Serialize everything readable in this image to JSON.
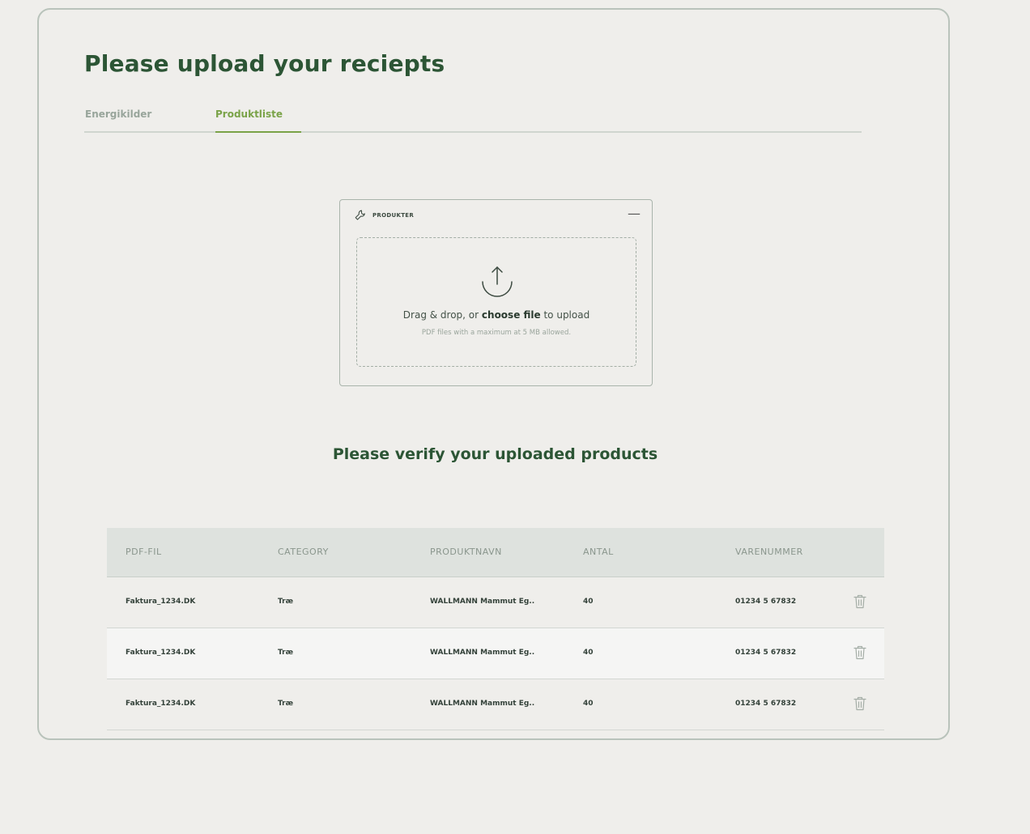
{
  "page": {
    "title": "Please upload your reciepts"
  },
  "tabs": [
    {
      "label": "Energikilder",
      "active": false
    },
    {
      "label": "Produktliste",
      "active": true
    }
  ],
  "upload": {
    "panel_title": "PRODUKTER",
    "minimize_symbol": "—",
    "text_before": "Drag & drop, or ",
    "link": "choose file",
    "text_after": " to upload",
    "hint": "PDF files with a maximum at 5 MB allowed."
  },
  "verify": {
    "title": "Please verify your uploaded products"
  },
  "table": {
    "columns": [
      "PDF-FIL",
      "CATEGORY",
      "PRODUKTNAVN",
      "ANTAL",
      "VARENUMMER"
    ],
    "rows": [
      [
        "Faktura_1234.DK",
        "Træ",
        "WALLMANN Mammut Eg..",
        "40",
        "01234 5 67832"
      ],
      [
        "Faktura_1234.DK",
        "Træ",
        "WALLMANN Mammut Eg..",
        "40",
        "01234 5 67832"
      ],
      [
        "Faktura_1234.DK",
        "Træ",
        "WALLMANN Mammut Eg..",
        "40",
        "01234 5 67832"
      ]
    ]
  },
  "colors": {
    "title_green": "#2c5535",
    "accent_green": "#7aa348",
    "background": "#efeeeb",
    "header_bg": "#dee2de"
  },
  "icons": {
    "panel": "wrench-icon",
    "upload": "upload-arrow-icon",
    "row_action": "trash-icon"
  }
}
